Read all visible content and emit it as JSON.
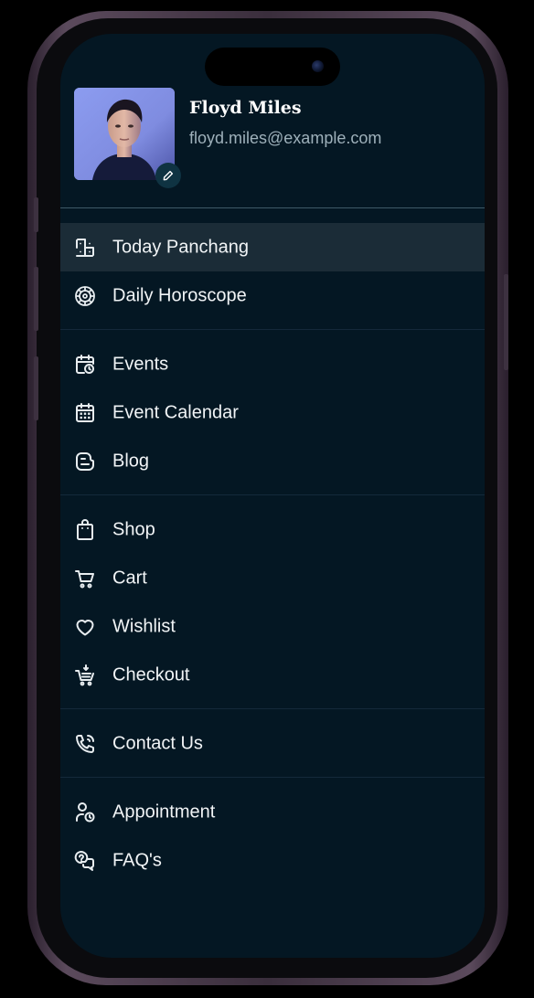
{
  "profile": {
    "name": "Floyd Miles",
    "email": "floyd.miles@example.com",
    "avatar_icon": "user-photo",
    "edit_icon": "pencil-icon"
  },
  "menu": {
    "sections": [
      {
        "items": [
          {
            "label": "Today Panchang",
            "icon": "swastika-icon",
            "active": true
          },
          {
            "label": "Daily Horoscope",
            "icon": "zodiac-wheel-icon",
            "active": false
          }
        ]
      },
      {
        "items": [
          {
            "label": "Events",
            "icon": "calendar-clock-icon"
          },
          {
            "label": "Event Calendar",
            "icon": "calendar-grid-icon"
          },
          {
            "label": "Blog",
            "icon": "blogger-icon"
          }
        ]
      },
      {
        "items": [
          {
            "label": "Shop",
            "icon": "shopping-bag-icon"
          },
          {
            "label": "Cart",
            "icon": "cart-icon"
          },
          {
            "label": "Wishlist",
            "icon": "heart-icon"
          },
          {
            "label": "Checkout",
            "icon": "cart-checkout-icon"
          }
        ]
      },
      {
        "items": [
          {
            "label": "Contact Us",
            "icon": "phone-call-icon"
          }
        ]
      },
      {
        "items": [
          {
            "label": "Appointment",
            "icon": "user-clock-icon"
          },
          {
            "label": "FAQ's",
            "icon": "faq-chat-icon"
          }
        ]
      }
    ]
  },
  "colors": {
    "screen_bg": "#041723",
    "active_bg": "#1b2c37",
    "text": "#f1f4f6",
    "email_text": "#9eb0ba"
  }
}
